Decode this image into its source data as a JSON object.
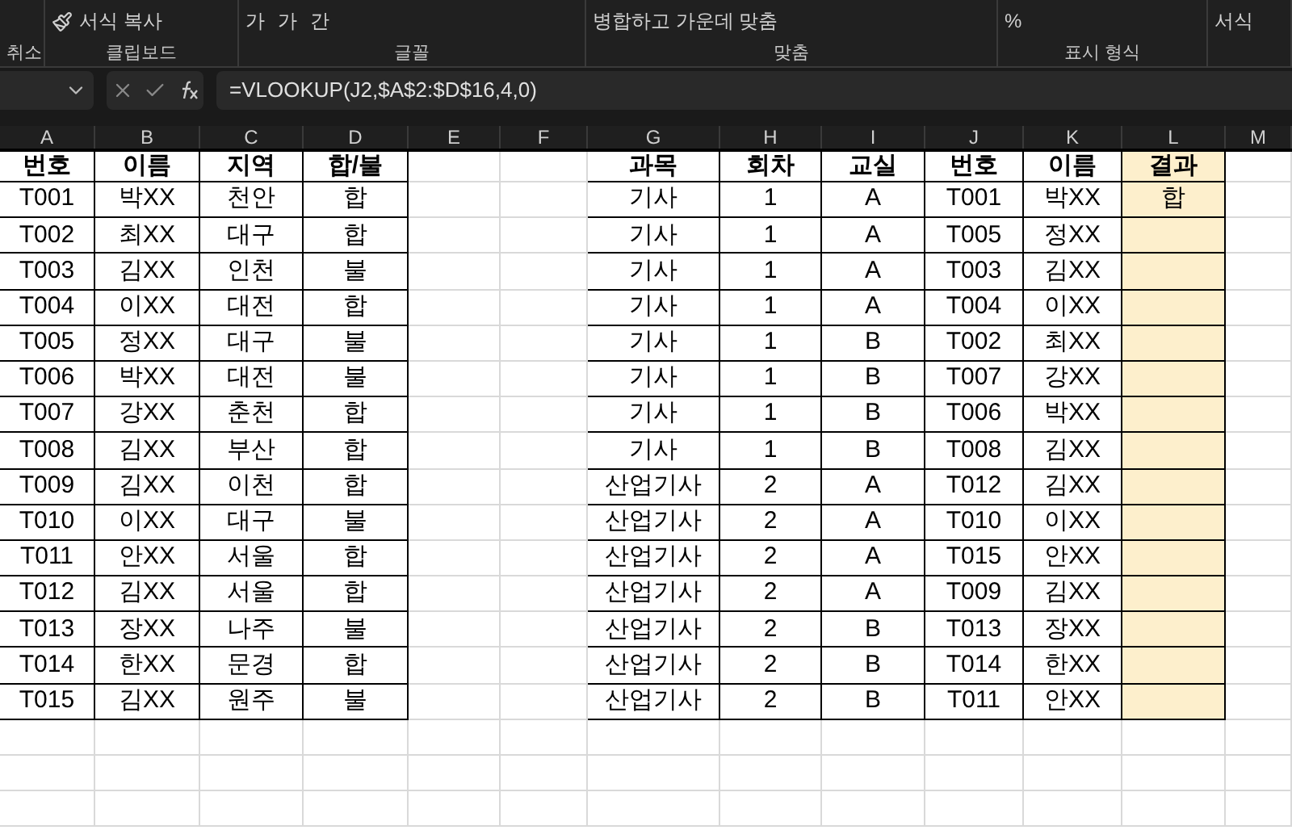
{
  "ribbon": {
    "groups": [
      {
        "label": "취소"
      },
      {
        "label": "클립보드",
        "items": [
          {
            "kind": "button",
            "text": "서식 복사"
          }
        ]
      },
      {
        "label": "글꼴",
        "items": [
          {
            "kind": "text",
            "text": "가"
          },
          {
            "kind": "text",
            "text": "가"
          },
          {
            "kind": "text",
            "text": "간"
          }
        ]
      },
      {
        "label": "맞춤",
        "items": [
          {
            "kind": "button",
            "text": "병합하고 가운데 맞춤"
          }
        ]
      },
      {
        "label": "표시 형식",
        "items": [
          {
            "kind": "text",
            "text": "%"
          }
        ]
      },
      {
        "items": [
          {
            "kind": "button",
            "text": "서식"
          }
        ]
      }
    ]
  },
  "formula_bar": {
    "formula": "=VLOOKUP(J2,$A$2:$D$16,4,0)"
  },
  "columns": [
    "A",
    "B",
    "C",
    "D",
    "E",
    "F",
    "G",
    "H",
    "I",
    "J",
    "K",
    "L",
    "M"
  ],
  "left_table": {
    "headers": [
      "번호",
      "이름",
      "지역",
      "합/불"
    ],
    "rows": [
      [
        "T001",
        "박XX",
        "천안",
        "합"
      ],
      [
        "T002",
        "최XX",
        "대구",
        "합"
      ],
      [
        "T003",
        "김XX",
        "인천",
        "불"
      ],
      [
        "T004",
        "이XX",
        "대전",
        "합"
      ],
      [
        "T005",
        "정XX",
        "대구",
        "불"
      ],
      [
        "T006",
        "박XX",
        "대전",
        "불"
      ],
      [
        "T007",
        "강XX",
        "춘천",
        "합"
      ],
      [
        "T008",
        "김XX",
        "부산",
        "합"
      ],
      [
        "T009",
        "김XX",
        "이천",
        "합"
      ],
      [
        "T010",
        "이XX",
        "대구",
        "불"
      ],
      [
        "T011",
        "안XX",
        "서울",
        "합"
      ],
      [
        "T012",
        "김XX",
        "서울",
        "합"
      ],
      [
        "T013",
        "장XX",
        "나주",
        "불"
      ],
      [
        "T014",
        "한XX",
        "문경",
        "합"
      ],
      [
        "T015",
        "김XX",
        "원주",
        "불"
      ]
    ]
  },
  "right_table": {
    "headers": [
      "과목",
      "회차",
      "교실",
      "번호",
      "이름",
      "결과"
    ],
    "rows": [
      [
        "기사",
        "1",
        "A",
        "T001",
        "박XX",
        "합"
      ],
      [
        "기사",
        "1",
        "A",
        "T005",
        "정XX"
      ],
      [
        "기사",
        "1",
        "A",
        "T003",
        "김XX"
      ],
      [
        "기사",
        "1",
        "A",
        "T004",
        "이XX"
      ],
      [
        "기사",
        "1",
        "B",
        "T002",
        "최XX"
      ],
      [
        "기사",
        "1",
        "B",
        "T007",
        "강XX"
      ],
      [
        "기사",
        "1",
        "B",
        "T006",
        "박XX"
      ],
      [
        "기사",
        "1",
        "B",
        "T008",
        "김XX"
      ],
      [
        "산업기사",
        "2",
        "A",
        "T012",
        "김XX"
      ],
      [
        "산업기사",
        "2",
        "A",
        "T010",
        "이XX"
      ],
      [
        "산업기사",
        "2",
        "A",
        "T015",
        "안XX"
      ],
      [
        "산업기사",
        "2",
        "A",
        "T009",
        "김XX"
      ],
      [
        "산업기사",
        "2",
        "B",
        "T013",
        "장XX"
      ],
      [
        "산업기사",
        "2",
        "B",
        "T014",
        "한XX"
      ],
      [
        "산업기사",
        "2",
        "B",
        "T011",
        "안XX"
      ]
    ]
  }
}
